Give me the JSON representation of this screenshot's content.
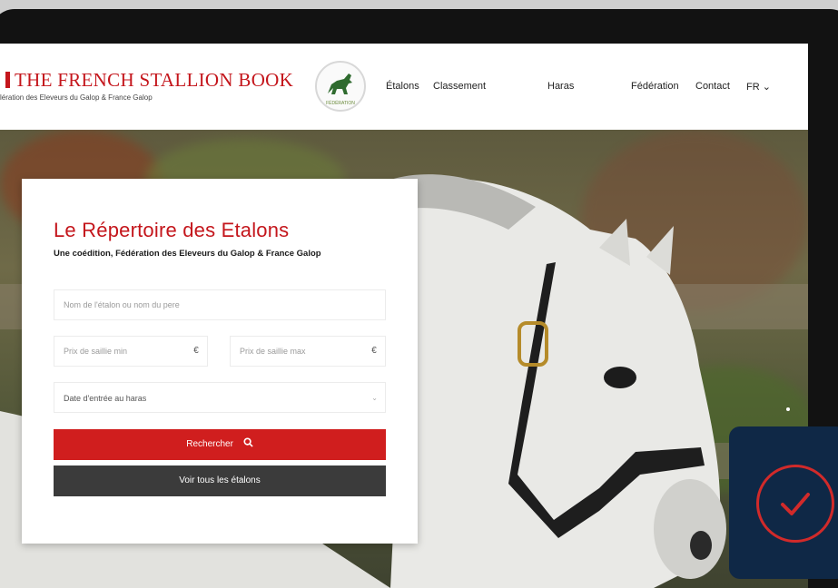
{
  "header": {
    "brand_title": "THE FRENCH STALLION BOOK",
    "brand_subtitle": "lération des Eleveurs du Galop & France Galop",
    "logo_caption": "FÉDÉRATION",
    "nav": [
      "Étalons",
      "Classement",
      "Haras",
      "Fédération",
      "Contact"
    ],
    "lang": "FR ⌄"
  },
  "search": {
    "title": "Le Répertoire des Etalons",
    "subtitle": "Une coédition, Fédération des Eleveurs du Galop & France Galop",
    "name_placeholder": "Nom de l'étalon ou nom du pere",
    "price_min_placeholder": "Prix de saillie min",
    "price_max_placeholder": "Prix de saillie max",
    "currency": "€",
    "date_placeholder": "Date d'entrée au haras",
    "search_button": "Rechercher",
    "search_icon": "🔍︎",
    "all_button": "Voir tous les étalons"
  },
  "colors": {
    "brand_red": "#c4161c",
    "button_red": "#d01e1e",
    "button_dark": "#3b3b3b",
    "badge_navy": "#0f2846"
  },
  "icons": {
    "search": "search-icon",
    "check": "check-circle-icon",
    "chevron": "chevron-down-icon"
  }
}
